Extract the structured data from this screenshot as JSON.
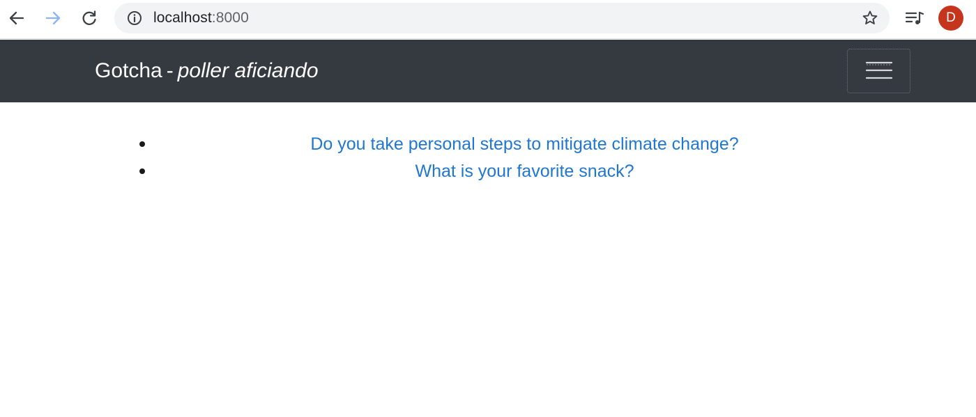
{
  "browser": {
    "url_host": "localhost",
    "url_port": ":8000",
    "avatar_initial": "D"
  },
  "navbar": {
    "brand_name": "Gotcha",
    "brand_separator": "-",
    "brand_tagline": "poller aficiando"
  },
  "polls": [
    {
      "question": "Do you take personal steps to mitigate climate change?"
    },
    {
      "question": "What is your favorite snack?"
    }
  ],
  "colors": {
    "navbar_bg": "#343a40",
    "link": "#1f76d3",
    "avatar_bg": "#c5341c",
    "omnibox_bg": "#f1f3f4"
  },
  "icons": [
    "back-arrow-icon",
    "forward-arrow-icon",
    "reload-icon",
    "info-icon",
    "star-icon",
    "media-queue-icon",
    "hamburger-icon"
  ]
}
